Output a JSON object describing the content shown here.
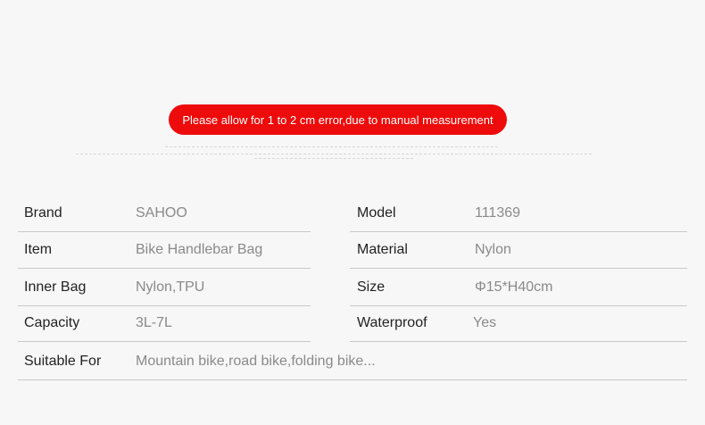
{
  "banner": {
    "text": "Please allow for 1 to 2 cm error,due to manual measurement",
    "color": "#ee0b0b"
  },
  "specs": {
    "brand": {
      "label": "Brand",
      "value": "SAHOO"
    },
    "model": {
      "label": "Model",
      "value": "111369"
    },
    "item": {
      "label": "Item",
      "value": "Bike Handlebar Bag"
    },
    "material": {
      "label": "Material",
      "value": "Nylon"
    },
    "inner_bag": {
      "label": "Inner Bag",
      "value": "Nylon,TPU"
    },
    "size": {
      "label": "Size",
      "value": "Φ15*H40cm"
    },
    "capacity": {
      "label": "Capacity",
      "value": "3L-7L"
    },
    "waterproof": {
      "label": "Waterproof",
      "value": "Yes"
    },
    "suitable_for": {
      "label": "Suitable For",
      "value": "Mountain bike,road bike,folding bike..."
    }
  }
}
